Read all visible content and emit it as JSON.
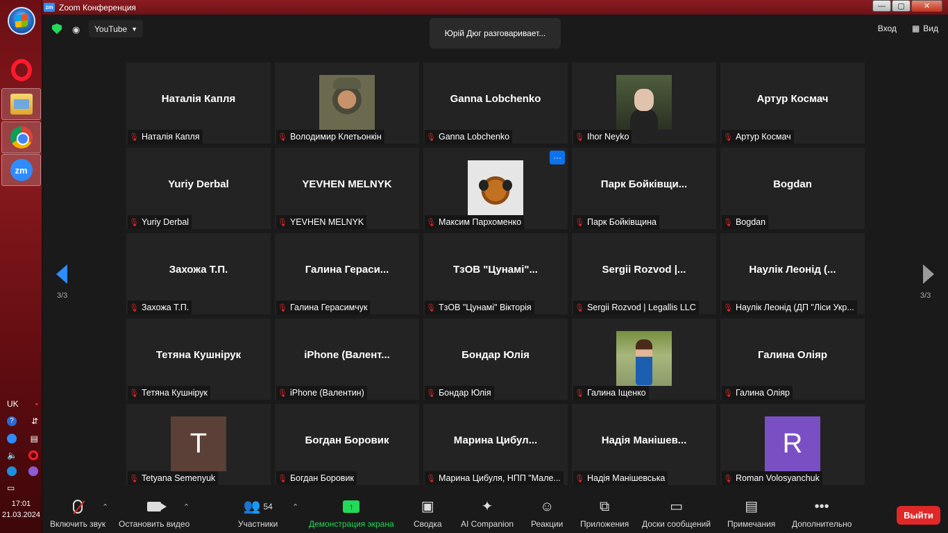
{
  "taskbar": {
    "lang": "UK",
    "clock_time": "17:01",
    "clock_date": "21.03.2024",
    "apps": [
      "opera-icon",
      "file-explorer-icon",
      "chrome-icon",
      "zoom-icon"
    ]
  },
  "window": {
    "title": "Zoom Конференция",
    "logo": "zm",
    "min": "—",
    "max": "▢",
    "close": "✕"
  },
  "topbar": {
    "live_label": "YouTube",
    "speaking": "Юрій Дюг разговаривает...",
    "exit_label": "Вход",
    "view_label": "Вид"
  },
  "nav": {
    "page_left": "3/3",
    "page_right": "3/3"
  },
  "participants": [
    {
      "display": "Наталія Капля",
      "label": "Наталія Капля"
    },
    {
      "display": "",
      "label": "Володимир Клетьонкін",
      "photo": "ph1"
    },
    {
      "display": "Ganna Lobchenko",
      "label": "Ganna Lobchenko"
    },
    {
      "display": "",
      "label": "Ihor Neyko",
      "photo": "ph2"
    },
    {
      "display": "Артур Космач",
      "label": "Артур Космач"
    },
    {
      "display": "Yuriy Derbal",
      "label": "Yuriy Derbal"
    },
    {
      "display": "YEVHEN MELNYK",
      "label": "YEVHEN MELNYK"
    },
    {
      "display": "",
      "label": "Максим Пархоменко",
      "photo": "ph3",
      "more": "···"
    },
    {
      "display": "Парк  Бойківщи...",
      "label": "Парк Бойківщина"
    },
    {
      "display": "Bogdan",
      "label": "Bogdan"
    },
    {
      "display": "Захожа Т.П.",
      "label": "Захожа Т.П."
    },
    {
      "display": "Галина  Гераси...",
      "label": "Галина Герасимчук"
    },
    {
      "display": "ТзОВ  \"Цунамі\"...",
      "label": "ТзОВ \"Цунамі\" Вікторія"
    },
    {
      "display": "Sergii  Rozvod  |...",
      "label": "Sergii Rozvod | Legallis LLC"
    },
    {
      "display": "Наулік  Леонід  (...",
      "label": "Наулік Леонід (ДП \"Ліси Укр..."
    },
    {
      "display": "Тетяна Кушнірук",
      "label": "Тетяна Кушнірук"
    },
    {
      "display": "iPhone  (Валент...",
      "label": "iPhone (Валентин)"
    },
    {
      "display": "Бондар Юлія",
      "label": "Бондар Юлія"
    },
    {
      "display": "",
      "label": "Галина Іщенко",
      "photo": "ph4"
    },
    {
      "display": "Галина Оліяр",
      "label": "Галина Оліяр"
    },
    {
      "display": "",
      "label": "Tetyana Semenyuk",
      "letter": "T",
      "letter_color": "#5b4038"
    },
    {
      "display": "Богдан Боровик",
      "label": "Богдан Боровик"
    },
    {
      "display": "Марина  Цибул...",
      "label": "Марина Цибуля, НПП \"Мале..."
    },
    {
      "display": "Надія  Манішев...",
      "label": "Надія Манішевська"
    },
    {
      "display": "",
      "label": "Roman Volosyanchuk",
      "letter": "R",
      "letter_color": "#7b4fc4"
    }
  ],
  "toolbar": {
    "mute": "Включить звук",
    "video": "Остановить видео",
    "participants": "Участники",
    "participants_count": "54",
    "share": "Демонстрация экрана",
    "summary": "Сводка",
    "ai": "AI Companion",
    "reactions": "Реакции",
    "apps": "Приложения",
    "whiteboards": "Доски сообщений",
    "notes": "Примечания",
    "more": "Дополнительно",
    "leave": "Выйти"
  },
  "colors": {
    "accent": "#2d8cff",
    "share_green": "#23d959",
    "leave_red": "#e02828",
    "tile_bg": "#232323"
  }
}
